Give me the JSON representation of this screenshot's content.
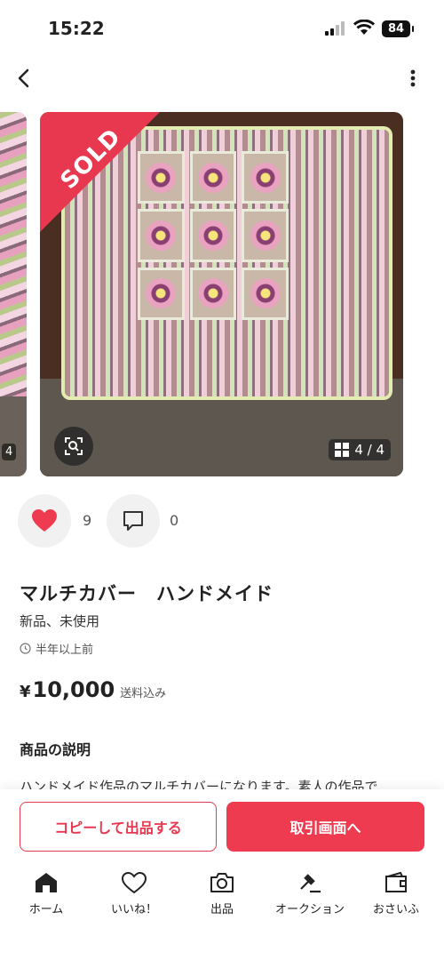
{
  "status_bar": {
    "time": "15:22",
    "battery": "84"
  },
  "photo": {
    "sold_label": "SOLD",
    "counter": "4 / 4",
    "prev_counter": "4"
  },
  "actions": {
    "likes_count": "9",
    "comments_count": "0"
  },
  "item": {
    "title": "マルチカバー　ハンドメイド",
    "condition": "新品、未使用",
    "posted_ago": "半年以上前",
    "currency": "¥",
    "price": "10,000",
    "shipping": "送料込み"
  },
  "description": {
    "heading": "商品の説明",
    "text": "ハンドメイド作品のマルチカバーになります。素人の作品で"
  },
  "buttons": {
    "copy_label": "コピーして出品する",
    "trade_label": "取引画面へ"
  },
  "tabbar": {
    "items": [
      {
        "label": "ホーム",
        "icon": "home-icon"
      },
      {
        "label": "いいね！",
        "icon": "heart-outline-icon"
      },
      {
        "label": "出品",
        "icon": "camera-icon"
      },
      {
        "label": "オークション",
        "icon": "gavel-icon"
      },
      {
        "label": "おさいふ",
        "icon": "wallet-icon"
      }
    ]
  },
  "colors": {
    "accent": "#ef3b50",
    "sold_banner": "#e8384f"
  }
}
